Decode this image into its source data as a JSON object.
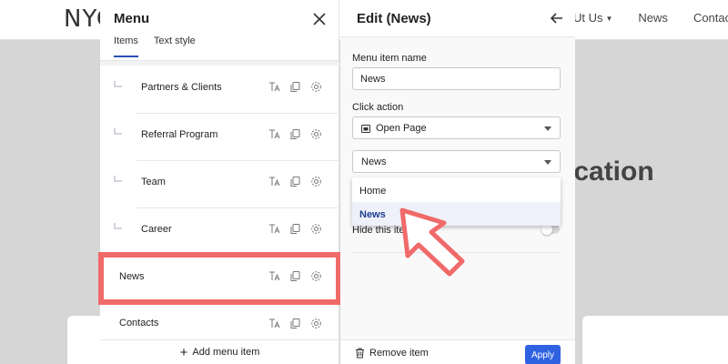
{
  "site": {
    "logo": "NYC",
    "nav": [
      "Ut Us",
      "News",
      "Contacts"
    ],
    "hero_text": "fication"
  },
  "menu_panel": {
    "title": "Menu",
    "tabs": [
      {
        "label": "Items",
        "active": true
      },
      {
        "label": "Text style",
        "active": false
      }
    ],
    "items": [
      {
        "label": "Partners & Clients",
        "sub": true
      },
      {
        "label": "Referral Program",
        "sub": true
      },
      {
        "label": "Team",
        "sub": true
      },
      {
        "label": "Career",
        "sub": true
      },
      {
        "label": "News",
        "sub": false,
        "highlighted": true
      },
      {
        "label": "Contacts",
        "sub": false
      }
    ],
    "add_label": "Add menu item"
  },
  "edit_panel": {
    "title": "Edit (News)",
    "name_label": "Menu item name",
    "name_value": "News",
    "action_label": "Click action",
    "action_value": "Open Page",
    "page_value": "News",
    "dropdown_options": [
      {
        "label": "Home",
        "selected": false
      },
      {
        "label": "News",
        "selected": true
      }
    ],
    "hide_label": "Hide this ite",
    "remove_label": "Remove item",
    "apply_label": "Apply"
  },
  "colors": {
    "accent": "#2f62e0",
    "highlight": "#f06a6a",
    "selected_text": "#1c3d8f"
  }
}
